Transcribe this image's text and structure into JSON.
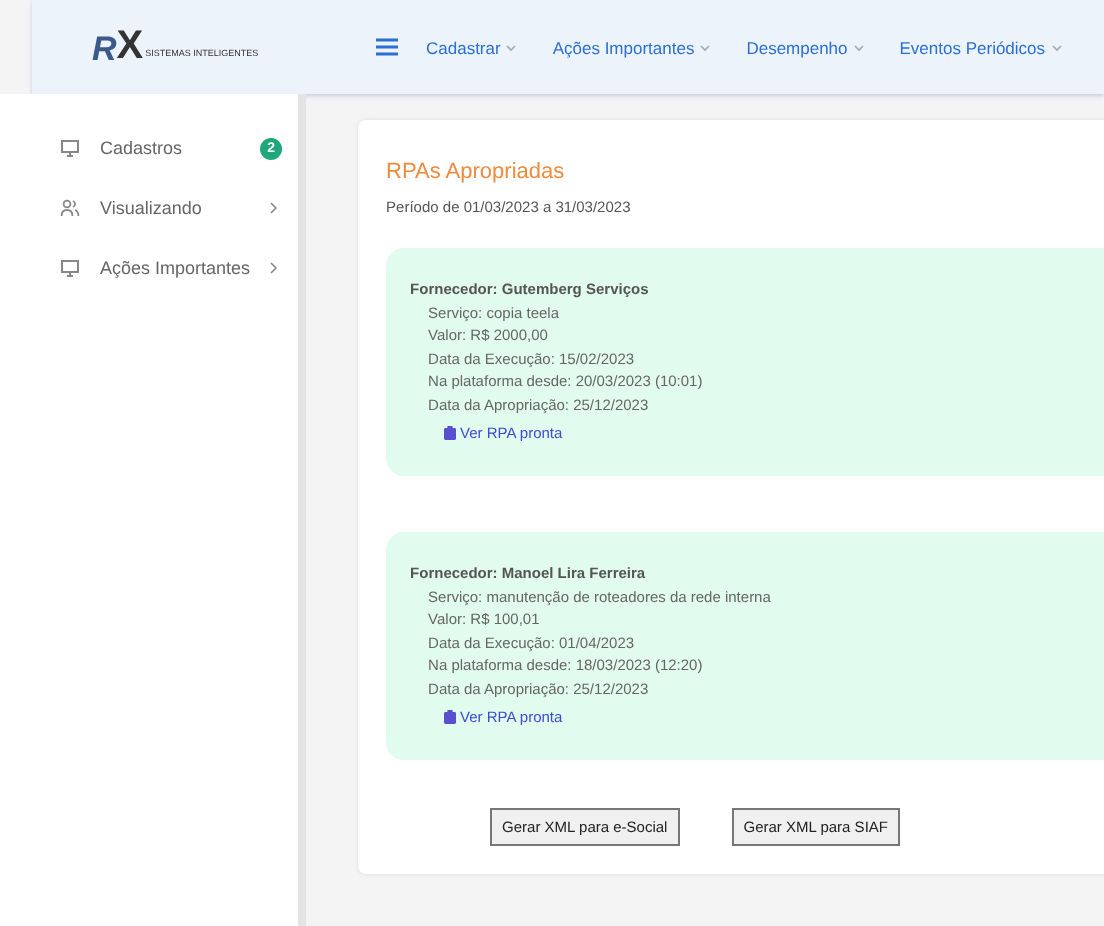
{
  "logo": {
    "letter_1": "R",
    "letter_2": "X",
    "tagline": "SISTEMAS INTELIGENTES"
  },
  "nav": [
    {
      "label": "Cadastrar"
    },
    {
      "label": "Ações Importantes"
    },
    {
      "label": "Desempenho"
    },
    {
      "label": "Eventos Periódicos"
    }
  ],
  "sidebar": {
    "items": [
      {
        "label": "Cadastros",
        "kind": "monitor",
        "badge": "2",
        "has_submenu": false
      },
      {
        "label": "Visualizando",
        "kind": "users",
        "has_submenu": true
      },
      {
        "label": "Ações Importantes",
        "kind": "monitor",
        "has_submenu": true
      }
    ]
  },
  "page": {
    "title": "RPAs Apropriadas",
    "subtitle": "Período de 01/03/2023 a 31/03/2023"
  },
  "rpas": [
    {
      "supplier": "Fornecedor: Gutemberg Serviços",
      "details": [
        "Serviço: copia teela",
        "Valor: R$ 2000,00",
        "Data da Execução: 15/02/2023",
        "Na plataforma desde: 20/03/2023 (10:01)",
        "Data da Apropriação: 25/12/2023"
      ],
      "link": "Ver RPA pronta"
    },
    {
      "supplier": "Fornecedor: Manoel Lira Ferreira",
      "details": [
        "Serviço: manutenção de roteadores da rede interna",
        "Valor: R$ 100,01",
        "Data da Execução: 01/04/2023",
        "Na plataforma desde: 18/03/2023 (12:20)",
        "Data da Apropriação: 25/12/2023"
      ],
      "link": "Ver RPA pronta"
    }
  ],
  "buttons": [
    "Gerar XML para e-Social",
    "Gerar XML para SIAF"
  ]
}
